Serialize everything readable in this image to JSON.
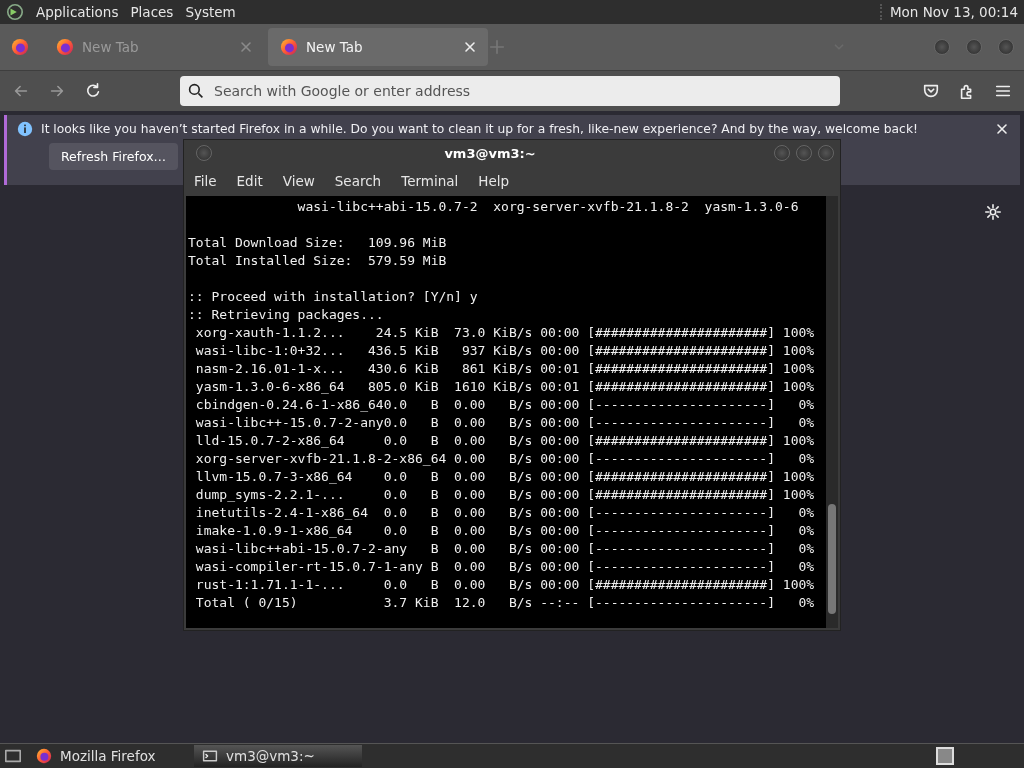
{
  "top_panel": {
    "menus": [
      "Applications",
      "Places",
      "System"
    ],
    "clock": "Mon Nov 13, 00:14"
  },
  "browser": {
    "tabs": [
      {
        "label": "New Tab",
        "selected": false
      },
      {
        "label": "New Tab",
        "selected": true
      }
    ],
    "address": {
      "placeholder": "Search with Google or enter address"
    },
    "notification": {
      "message": "It looks like you haven’t started Firefox in a while. Do you want to clean it up for a fresh, like-new experience? And by the way, welcome back!",
      "button": "Refresh Firefox…"
    }
  },
  "terminal": {
    "title": "vm3@vm3:~",
    "menu": [
      "File",
      "Edit",
      "View",
      "Search",
      "Terminal",
      "Help"
    ],
    "blocks": [
      [
        "              wasi-libc++abi-15.0.7-2  xorg-server-xvfb-21.1.8-2  yasm-1.3.0-6"
      ],
      [
        "Total Download Size:   109.96 MiB",
        "Total Installed Size:  579.59 MiB"
      ],
      [
        ":: Proceed with installation? [Y/n] y",
        ":: Retrieving packages...",
        " xorg-xauth-1.1.2...    24.5 KiB  73.0 KiB/s 00:00 [######################] 100%",
        " wasi-libc-1:0+32...   436.5 KiB   937 KiB/s 00:00 [######################] 100%",
        " nasm-2.16.01-1-x...   430.6 KiB   861 KiB/s 00:01 [######################] 100%",
        " yasm-1.3.0-6-x86_64   805.0 KiB  1610 KiB/s 00:01 [######################] 100%",
        " cbindgen-0.24.6-1-x86_640.0   B  0.00   B/s 00:00 [----------------------]   0%",
        " wasi-libc++-15.0.7-2-any0.0   B  0.00   B/s 00:00 [----------------------]   0%",
        " lld-15.0.7-2-x86_64     0.0   B  0.00   B/s 00:00 [######################] 100%",
        " xorg-server-xvfb-21.1.8-2-x86_64 0.00   B/s 00:00 [----------------------]   0%",
        " llvm-15.0.7-3-x86_64    0.0   B  0.00   B/s 00:00 [######################] 100%",
        " dump_syms-2.2.1-...     0.0   B  0.00   B/s 00:00 [######################] 100%",
        " inetutils-2.4-1-x86_64  0.0   B  0.00   B/s 00:00 [----------------------]   0%",
        " imake-1.0.9-1-x86_64    0.0   B  0.00   B/s 00:00 [----------------------]   0%",
        " wasi-libc++abi-15.0.7-2-any   B  0.00   B/s 00:00 [----------------------]   0%",
        " wasi-compiler-rt-15.0.7-1-any B  0.00   B/s 00:00 [----------------------]   0%",
        " rust-1:1.71.1-1-...     0.0   B  0.00   B/s 00:00 [######################] 100%",
        " Total ( 0/15)           3.7 KiB  12.0   B/s --:-- [----------------------]   0%"
      ]
    ]
  },
  "taskbar": {
    "items": [
      {
        "label": "Mozilla Firefox",
        "kind": "firefox",
        "selected": false
      },
      {
        "label": "vm3@vm3:~",
        "kind": "terminal",
        "selected": true
      }
    ]
  }
}
